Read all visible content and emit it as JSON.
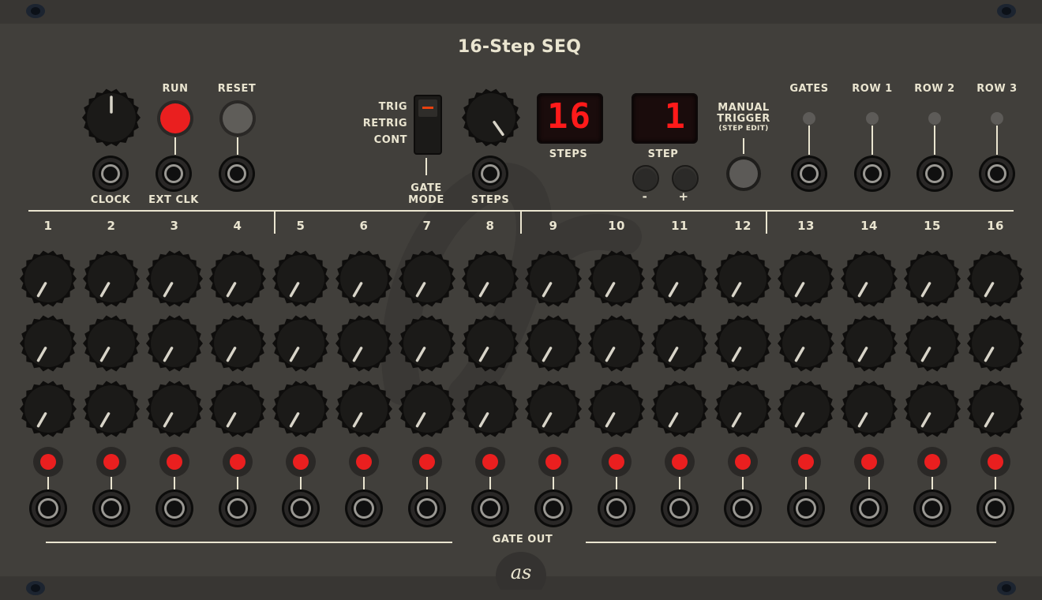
{
  "module": {
    "title": "16-Step SEQ",
    "run_label": "RUN",
    "reset_label": "RESET",
    "clock_label": "CLOCK",
    "extclk_label": "EXT CLK",
    "gate_mode_options": [
      "TRIG",
      "RETRIG",
      "CONT"
    ],
    "gate_mode_label_1": "GATE",
    "gate_mode_label_2": "MODE",
    "steps_knob_label": "STEPS",
    "steps_display_value": "16",
    "steps_display_label": "STEPS",
    "step_display_value": "1",
    "step_display_label": "STEP",
    "step_minus_label": "-",
    "step_plus_label": "+",
    "manual_trigger_label_1": "MANUAL",
    "manual_trigger_label_2": "TRIGGER",
    "manual_trigger_label_3": "(STEP EDIT)",
    "output_labels": [
      "GATES",
      "ROW 1",
      "ROW 2",
      "ROW 3"
    ],
    "step_numbers": [
      "1",
      "2",
      "3",
      "4",
      "5",
      "6",
      "7",
      "8",
      "9",
      "10",
      "11",
      "12",
      "13",
      "14",
      "15",
      "16"
    ],
    "gate_out_label": "GATE OUT",
    "logo_text": "as",
    "run_active": true,
    "gate_leds_on": [
      true,
      true,
      true,
      true,
      true,
      true,
      true,
      true,
      true,
      true,
      true,
      true,
      true,
      true,
      true,
      true
    ],
    "colors": {
      "panel": "#413f3b",
      "text": "#eae5d0",
      "led_red": "#ea1f1f",
      "display_red": "#ff1a1a",
      "switch_accent": "#e8410f"
    }
  }
}
